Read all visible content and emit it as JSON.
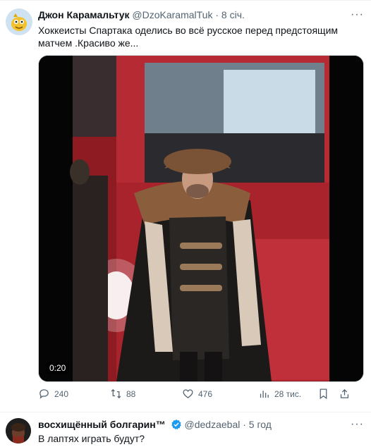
{
  "tweet": {
    "author_name": "Джон Карамальтук",
    "author_handle": "@DzoKaramalTuk",
    "separator": "·",
    "time": "8 січ.",
    "text": "Хоккеисты Спартака оделись во всё русское перед предстоящим матчем .Красиво же...",
    "media": {
      "timestamp": "0:20"
    },
    "actions": {
      "replies": "240",
      "reposts": "88",
      "likes": "476",
      "views": "28 тис."
    }
  },
  "reply": {
    "author_name": "восхищённый болгарин™",
    "author_handle": "@dedzaebal",
    "separator": "·",
    "time": "5 год",
    "text": "В лаптях играть будут?",
    "verified": true
  },
  "colors": {
    "verified_blue": "#1d9bf0",
    "muted": "#536471",
    "text": "#0f1419",
    "divider": "#eff3f4"
  }
}
